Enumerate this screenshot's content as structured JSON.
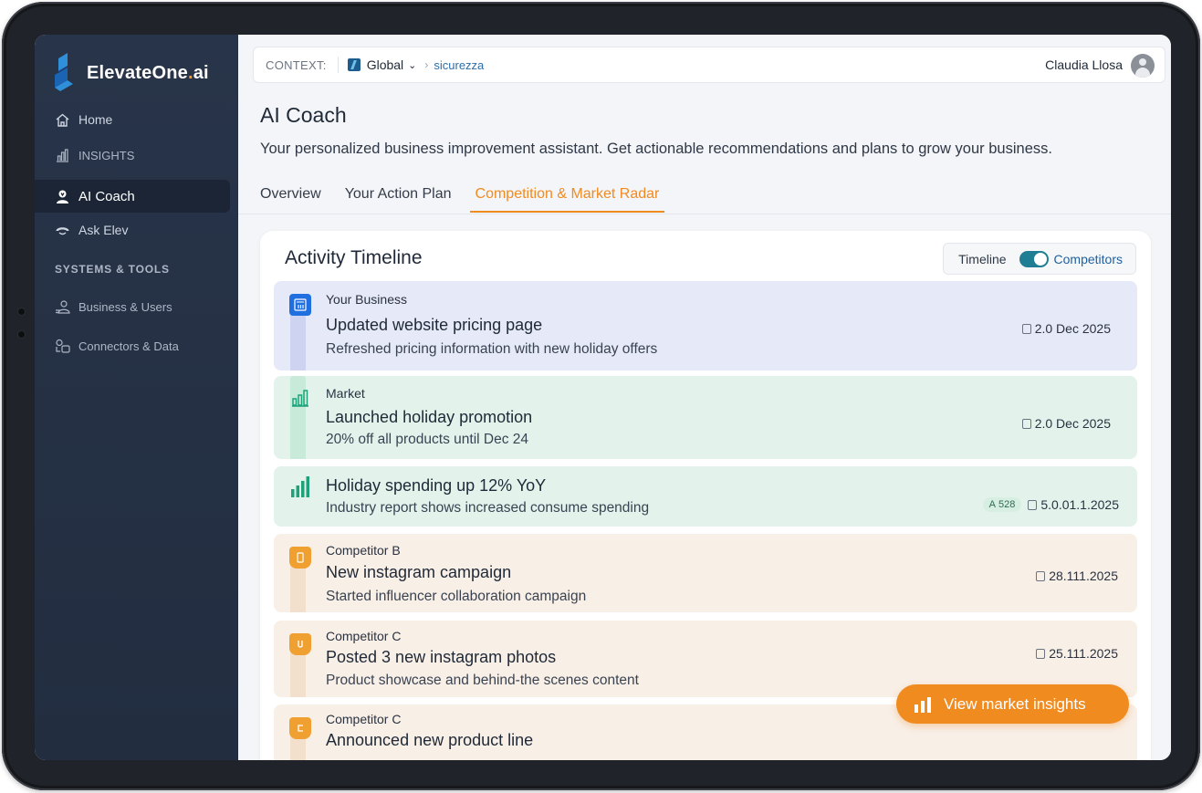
{
  "brand": {
    "name": "ElevateOne",
    "dot": ".",
    "tld": "ai"
  },
  "sidebar": {
    "items": [
      {
        "label": "Home",
        "icon": "home-icon"
      },
      {
        "label": "INSIGHTS",
        "icon": "bar-chart-icon"
      },
      {
        "label": "AI Coach",
        "icon": "user-coach-icon",
        "active": true
      },
      {
        "label": "Ask Elev",
        "icon": "chat-icon"
      }
    ],
    "section_title": "SYSTEMS & TOOLS",
    "tools": [
      {
        "label": "Business & Users",
        "icon": "users-icon"
      },
      {
        "label": "Connectors & Data",
        "icon": "connectors-icon"
      }
    ]
  },
  "topbar": {
    "context_label": "CONTEXT:",
    "context_value": "Global",
    "breadcrumb": "sicurezza",
    "user_name": "Claudia Llosa"
  },
  "page": {
    "title": "AI Coach",
    "subtitle": "Your personalized business improvement assistant. Get actionable recommendations and plans to grow your business.",
    "tabs": [
      {
        "label": "Overview"
      },
      {
        "label": "Your Action Plan"
      },
      {
        "label": "Competition & Market Radar",
        "active": true
      }
    ]
  },
  "timeline": {
    "title": "Activity Timeline",
    "toggle_left": "Timeline",
    "toggle_right": "Competitors",
    "items": [
      {
        "source": "Your Business",
        "title": "Updated website pricing page",
        "desc": "Refreshed pricing information with new holiday offers",
        "date": "2.0 Dec 2025"
      },
      {
        "source": "Market",
        "title": "Launched holiday promotion",
        "desc": "20% off all products until Dec 24",
        "date": "2.0 Dec 2025"
      },
      {
        "source": "",
        "title": "Holiday spending up 12% YoY",
        "desc": "Industry report shows increased consume spending",
        "badge": "528",
        "date": "5.0.01.1.2025"
      },
      {
        "source": "Competitor B",
        "title": "New instagram campaign",
        "desc": "Started influencer collaboration campaign",
        "date": "28.111.2025"
      },
      {
        "source": "Competitor C",
        "title": "Posted 3 new instagram photos",
        "desc": "Product showcase and behind-the scenes content",
        "date": "25.111.2025"
      },
      {
        "source": "Competitor C",
        "title": "Announced new product line",
        "desc": "",
        "date": ""
      }
    ]
  },
  "fab": {
    "label": "View market insights"
  },
  "colors": {
    "accent": "#f08b20",
    "sidebar": "#263247",
    "toggle": "#1f7d94"
  }
}
